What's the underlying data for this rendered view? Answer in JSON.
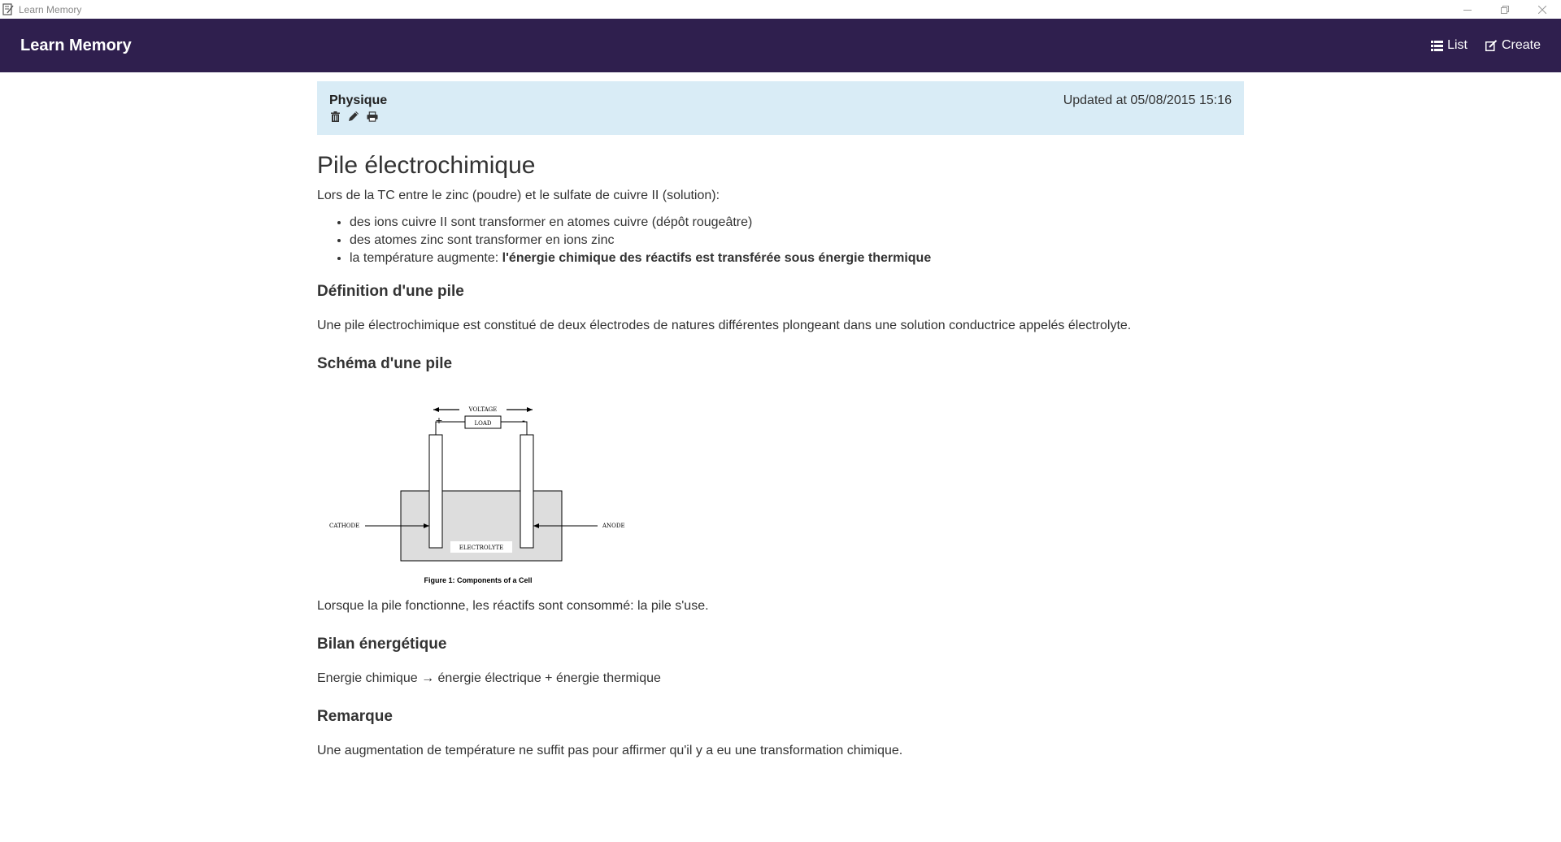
{
  "window": {
    "title": "Learn Memory",
    "controls": {
      "minimize": "minimize-icon",
      "restore": "restore-icon",
      "close": "close-icon"
    }
  },
  "navbar": {
    "brand": "Learn Memory",
    "links": [
      {
        "label": "List",
        "icon": "list-icon"
      },
      {
        "label": "Create",
        "icon": "edit-icon"
      }
    ],
    "background": "#2f1f4e"
  },
  "panel": {
    "category": "Physique",
    "updated": "Updated at 05/08/2015 15:16",
    "actions": [
      "trash-icon",
      "pencil-icon",
      "print-icon"
    ],
    "background": "#d9ecf6"
  },
  "content": {
    "title": "Pile électrochimique",
    "intro": "Lors de la TC entre le zinc (poudre) et le sulfate de cuivre II (solution):",
    "bullets": [
      "des ions cuivre II sont transformer en atomes cuivre (dépôt rougeâtre)",
      "des atomes zinc sont transformer en ions zinc"
    ],
    "bullet3_prefix": "la température augmente: ",
    "bullet3_bold": "l'énergie chimique des réactifs est transférée sous énergie thermique",
    "sections": [
      {
        "heading": "Définition d'une pile",
        "text": "Une pile électrochimique est constitué de deux électrodes de natures différentes plongeant dans une solution conductrice appelés électrolyte."
      },
      {
        "heading": "Schéma d'une pile",
        "after_figure": "Lorsque la pile fonctionne, les réactifs sont consommé: la pile s'use."
      },
      {
        "heading": "Bilan énergétique",
        "text": "Energie chimique → énergie électrique + énergie thermique"
      },
      {
        "heading": "Remarque",
        "text": "Une augmentation de température ne suffit pas pour affirmer qu'il y a eu une transformation chimique."
      }
    ],
    "figure": {
      "voltage": "VOLTAGE",
      "plus": "+",
      "minus": "-",
      "load": "LOAD",
      "cathode": "CATHODE",
      "anode": "ANODE",
      "electrolyte": "ELECTROLYTE",
      "caption": "Figure 1: Components of a Cell"
    }
  }
}
